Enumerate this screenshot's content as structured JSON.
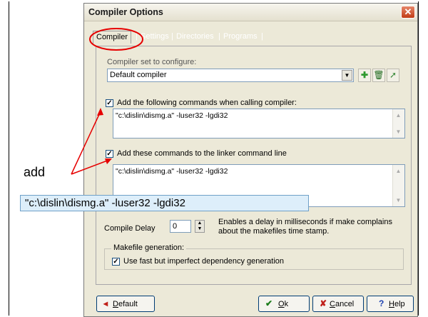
{
  "dialog": {
    "title": "Compiler Options",
    "close_glyph": "✕"
  },
  "tabs": [
    "Compiler",
    "Settings",
    "Directories",
    "Programs"
  ],
  "compiler_set": {
    "label": "Compiler set to configure:",
    "value": "Default compiler"
  },
  "compiler_cmds": {
    "checked": true,
    "label": "Add the following commands when calling compiler:",
    "text": "\"c:\\dislin\\dismg.a\" -luser32 -lgdi32"
  },
  "linker_cmds": {
    "checked": true,
    "label": "Add these commands to the linker command line",
    "text": "\"c:\\dislin\\dismg.a\" -luser32 -lgdi32"
  },
  "compile_delay": {
    "label": "Compile Delay",
    "value": "0",
    "help": "Enables a delay in milliseconds if make complains",
    "help2": "about the makefiles time stamp."
  },
  "makefile": {
    "group_label": "Makefile generation:",
    "checked": true,
    "option": "Use fast but imperfect dependency generation"
  },
  "buttons": {
    "default": {
      "prefix": "",
      "key": "D",
      "rest": "efault"
    },
    "ok": {
      "key": "O",
      "rest": "k"
    },
    "cancel": {
      "key": "C",
      "rest": "ancel"
    },
    "help": {
      "key": "H",
      "rest": "elp"
    }
  },
  "annotation": {
    "side_text": "add",
    "callout_text": "\"c:\\dislin\\dismg.a\" -luser32 -lgdi32",
    "color": "#FF0000"
  },
  "icons": [
    "add-icon",
    "delete-icon",
    "rename-icon",
    "close-icon",
    "check-icon",
    "x-icon",
    "help-icon",
    "back-arrow-icon"
  ]
}
